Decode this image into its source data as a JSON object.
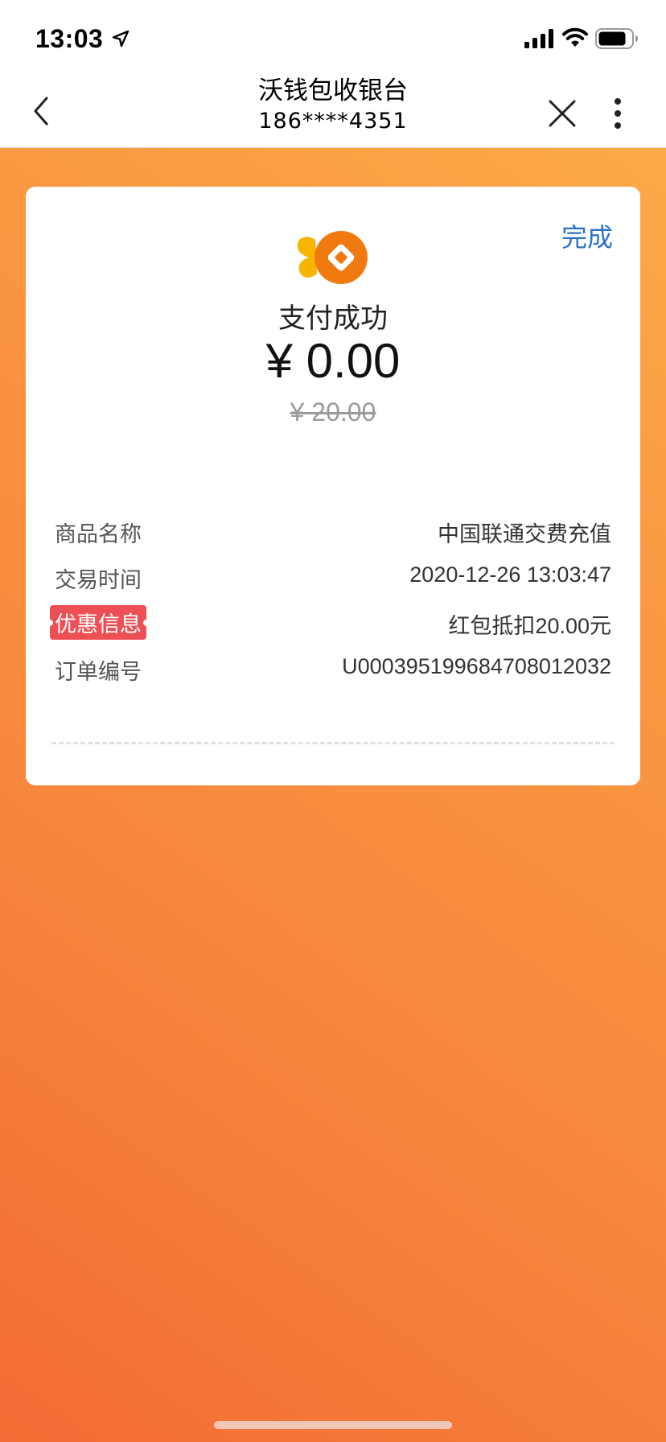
{
  "status_bar": {
    "time": "13:03",
    "icons": [
      "location-icon",
      "signal-icon",
      "wifi-icon",
      "battery-icon"
    ]
  },
  "nav": {
    "title": "沃钱包收银台",
    "subtitle": "186****4351",
    "back_icon": "back-icon",
    "close_icon": "close-icon",
    "more_icon": "more-icon"
  },
  "receipt": {
    "done_label": "完成",
    "status": "支付成功",
    "amount": "¥ 0.00",
    "original_amount": "¥ 20.00",
    "details": [
      {
        "label": "商品名称",
        "value": "中国联通交费充值"
      },
      {
        "label": "交易时间",
        "value": "2020-12-26 13:03:47"
      },
      {
        "label": "优惠信息",
        "value": "红包抵扣20.00元"
      },
      {
        "label": "订单编号",
        "value": "U0003951996847080120​32"
      }
    ]
  },
  "colors": {
    "accent": "#2a72c9",
    "promo_badge": "#ee4f55",
    "background_top": "#fdb04b",
    "background_bottom": "#f36c35",
    "logo_orange": "#f07a10",
    "logo_yellow": "#f7b500"
  }
}
